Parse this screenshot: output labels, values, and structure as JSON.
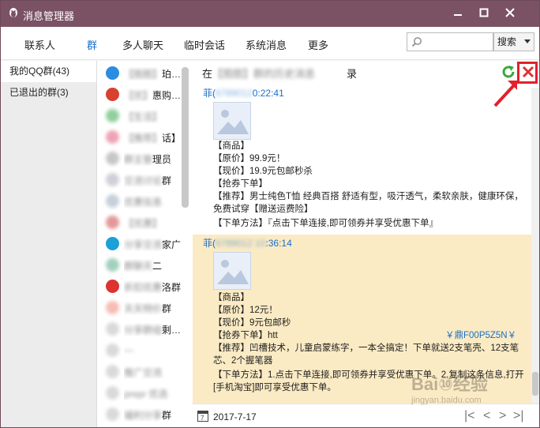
{
  "window": {
    "title": "消息管理器"
  },
  "menubar": {
    "tabs": [
      "联系人",
      "群",
      "多人聊天",
      "临时会话",
      "系统消息",
      "更多"
    ],
    "active_tab": "群",
    "search_placeholder": "",
    "search_button": "搜索"
  },
  "sidebar": {
    "items": [
      {
        "label": "我的QQ群(43)",
        "active": true
      },
      {
        "label": "已退出的群(3)",
        "active": false
      }
    ]
  },
  "group_list": {
    "visible_labels": [
      "珀…",
      "惠购…",
      "话】…",
      "理员",
      "群",
      "家广",
      "二",
      "洛群",
      "群",
      "剩…",
      "",
      "",
      "",
      "群"
    ]
  },
  "content": {
    "header_left": "在",
    "header_right": "录",
    "messages": [
      {
        "sender": "菲(",
        "time": "0:22:41",
        "lines": [
          "【商品】",
          "【原价】99.9元！",
          "【现价】19.9元包邮秒杀",
          "【抢券下单】",
          "【推荐】男士纯色T恤 经典百搭 舒适有型，吸汗透气，柔软亲肤，健康环保，免费试穿【赠送运费险】",
          "【下单方法】『点击下单连接,即可领券并享受优惠下单』"
        ]
      },
      {
        "sender": "菲(",
        "time": ":36:14",
        "lines": [
          "【商品】",
          "【原价】12元！",
          "【现价】9元包邮秒",
          "【抢券下单】htt",
          "【推荐】凹槽技术，儿童启蒙练字，一本全搞定！下单就送2支笔壳、12支笔芯、2个握笔器",
          "【下单方法】1.点击下单连接,即可领券并享受优惠下单。2.复制这条信息,打开[手机淘宝]即可享受优惠下单。"
        ],
        "code": "￥鼎F00P5Z5N￥"
      }
    ]
  },
  "footer": {
    "date": "2017-7-17"
  },
  "colors": {
    "titlebar": "#7a5264",
    "accent": "#1a6fc9",
    "highlight": "#fbebc4",
    "annotation": "#e4202a"
  },
  "watermark": {
    "main": "Bai⑩经验",
    "sub": "jingyan.baidu.com"
  }
}
